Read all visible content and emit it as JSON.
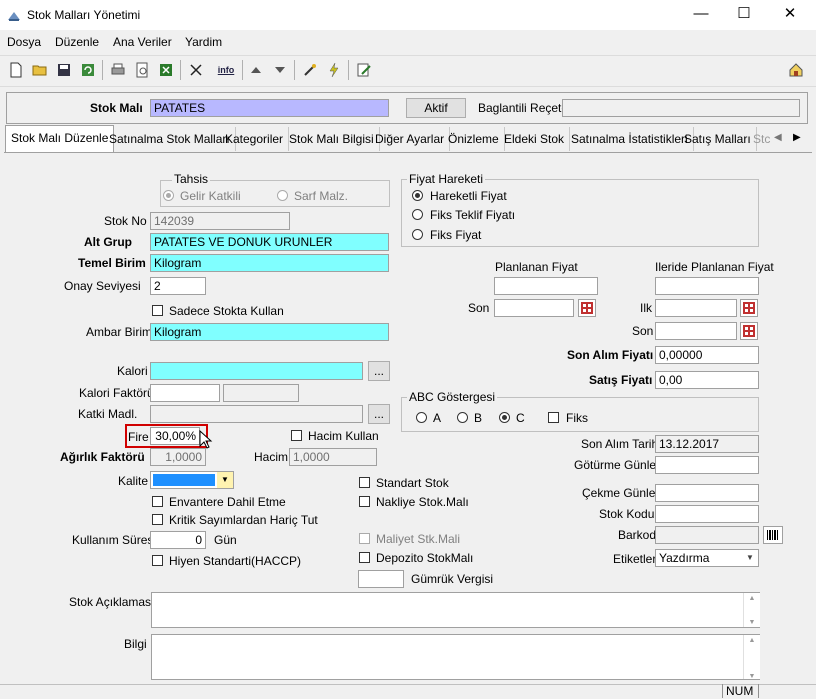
{
  "window": {
    "title": "Stok Malları Yönetimi",
    "minimize": "—",
    "maximize": "☐",
    "close": "✕"
  },
  "menu": [
    "Dosya",
    "Düzenle",
    "Ana Veriler",
    "Yardim"
  ],
  "header": {
    "stok_mali_label": "Stok Malı",
    "stok_mali_value": "PATATES",
    "aktif_button": "Aktif",
    "baglantili_label": "Baglantili Reçete",
    "baglantili_value": ""
  },
  "tabs": [
    "Stok Malı Düzenle",
    "Satınalma Stok Malları",
    "Kategoriler",
    "Stok Malı Bilgisi",
    "Diğer Ayarlar",
    "Önizleme",
    "Eldeki Stok",
    "Satınalma İstatistikleri",
    "Satış Malları",
    "Stc"
  ],
  "tahsis": {
    "legend": "Tahsis",
    "opt1": "Gelir Katkili",
    "opt2": "Sarf Malz."
  },
  "form": {
    "stok_no_label": "Stok No",
    "stok_no": "142039",
    "alt_grup_label": "Alt Grup",
    "alt_grup": "PATATES VE DONUK URUNLER",
    "temel_birim_label": "Temel Birim",
    "temel_birim": "Kilogram",
    "onay_label": "Onay Seviyesi",
    "onay": "2",
    "sadece_stokta": "Sadece Stokta Kullan",
    "ambar_label": "Ambar Birimi",
    "ambar": "Kilogram",
    "kalori_label": "Kalori",
    "kalori": "",
    "kalori_faktoru_label": "Kalori Faktörü",
    "katki_label": "Katki Madl.",
    "fire_label": "Fire",
    "fire": "30,00%",
    "hacim_kullan": "Hacim Kullan",
    "agirlik_label": "Ağırlık Faktörü",
    "agirlik": "1,0000",
    "hacim_label": "Hacim",
    "hacim": "1,0000",
    "kalite_label": "Kalite",
    "envantere": "Envantere Dahil Etme",
    "kritik": "Kritik Sayımlardan Hariç Tut",
    "kullanim_label": "Kullanım Süresi",
    "kullanim": "0",
    "gun": "Gün",
    "hiyen": "Hiyen Standarti(HACCP)",
    "standart_stok": "Standart Stok",
    "nakliye": "Nakliye Stok.Malı",
    "maliyet": "Maliyet Stk.Mali",
    "depozito": "Depozito StokMalı",
    "gumruk": "Gümrük Vergisi",
    "aciklama_label": "Stok Açıklaması",
    "bilgi_label": "Bilgi",
    "ellipsis": "..."
  },
  "fiyat": {
    "legend": "Fiyat Hareketi",
    "opt1": "Hareketli Fiyat",
    "opt2": "Fiks Teklif Fiyatı",
    "opt3": "Fiks Fiyat",
    "planlanan": "Planlanan Fiyat",
    "ileride": "Ileride Planlanan Fiyat",
    "son": "Son",
    "ilk": "Ilk",
    "son2": "Son",
    "son_alim_fiyati_label": "Son Alım Fiyatı",
    "son_alim_fiyati": "0,00000",
    "satis_fiyati_label": "Satış Fiyatı",
    "satis_fiyati": "0,00"
  },
  "abc": {
    "legend": "ABC Göstergesi",
    "a": "A",
    "b": "B",
    "c": "C",
    "fiks": "Fiks"
  },
  "right": {
    "son_alim_tarihi_label": "Son Alım Tarihi",
    "son_alim_tarihi": "13.12.2017",
    "gotume_label": "Götürme Günleri",
    "cekme_label": "Çekme Günleri",
    "stok_kodu_label": "Stok Kodu",
    "barkod_label": "Barkod",
    "etiketler_label": "Etiketler",
    "etiketler": "Yazdırma"
  },
  "status": {
    "num": "NUM"
  },
  "colors": {
    "cyan": "#80ffff",
    "lavender": "#b8b8ff",
    "highlight": "#d00000",
    "kalite": "#1e90ff"
  }
}
